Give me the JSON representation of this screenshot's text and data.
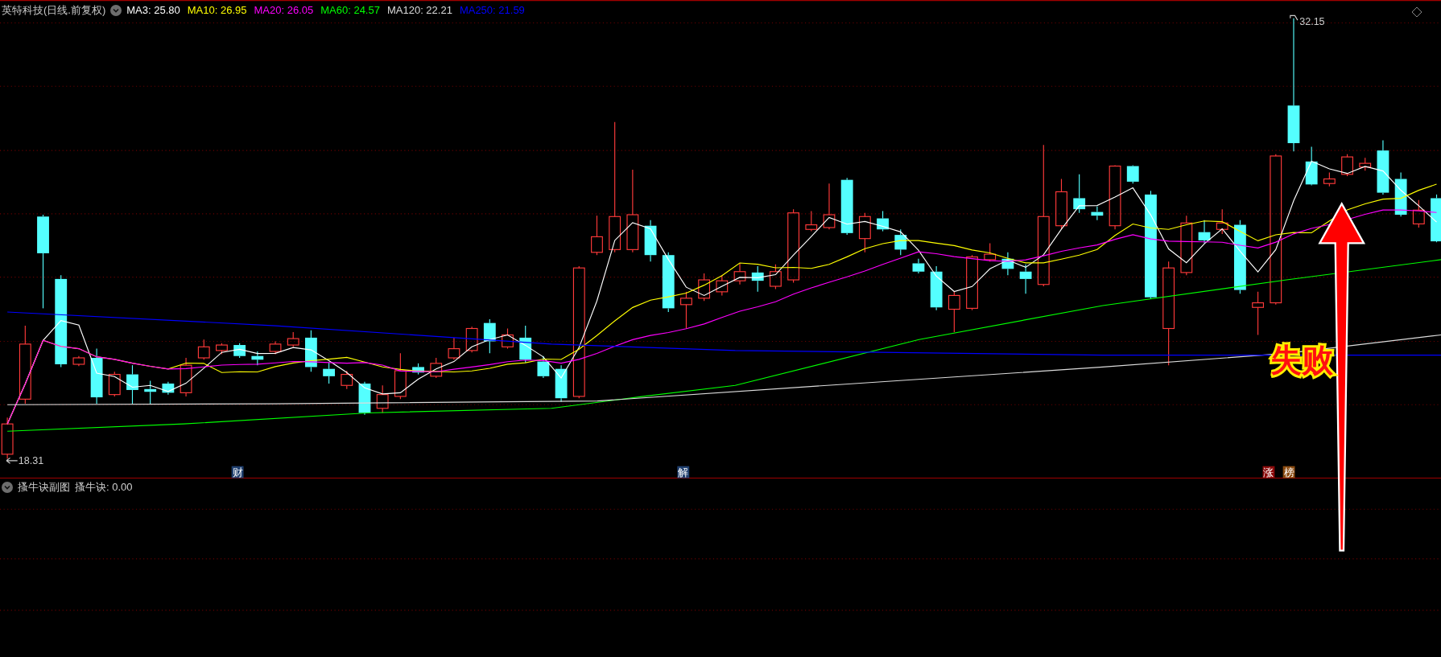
{
  "main_panel": {
    "title": "英特科技(日线.前复权)",
    "indicators": [
      {
        "label": "MA3: 25.80",
        "color": "#ffffff"
      },
      {
        "label": "MA10: 26.95",
        "color": "#ffff00"
      },
      {
        "label": "MA20: 26.05",
        "color": "#ff00ff"
      },
      {
        "label": "MA60: 24.57",
        "color": "#00ff00"
      },
      {
        "label": "MA120: 22.21",
        "color": "#dcdcdc"
      },
      {
        "label": "MA250: 21.59",
        "color": "#0000ff"
      }
    ],
    "high_label": "32.15",
    "low_label": "18.31",
    "event_markers": [
      {
        "text": "财",
        "color": "#1f3f6e"
      },
      {
        "text": "解",
        "color": "#1f3f6e"
      },
      {
        "text": "涨",
        "color": "#8b0a0a"
      },
      {
        "text": "榜",
        "color": "#8a4a10"
      }
    ]
  },
  "sub_panel": {
    "title": "搔牛诀副图",
    "indicator": "搔牛诀: 0.00"
  },
  "annotation": {
    "text": "失败"
  }
}
